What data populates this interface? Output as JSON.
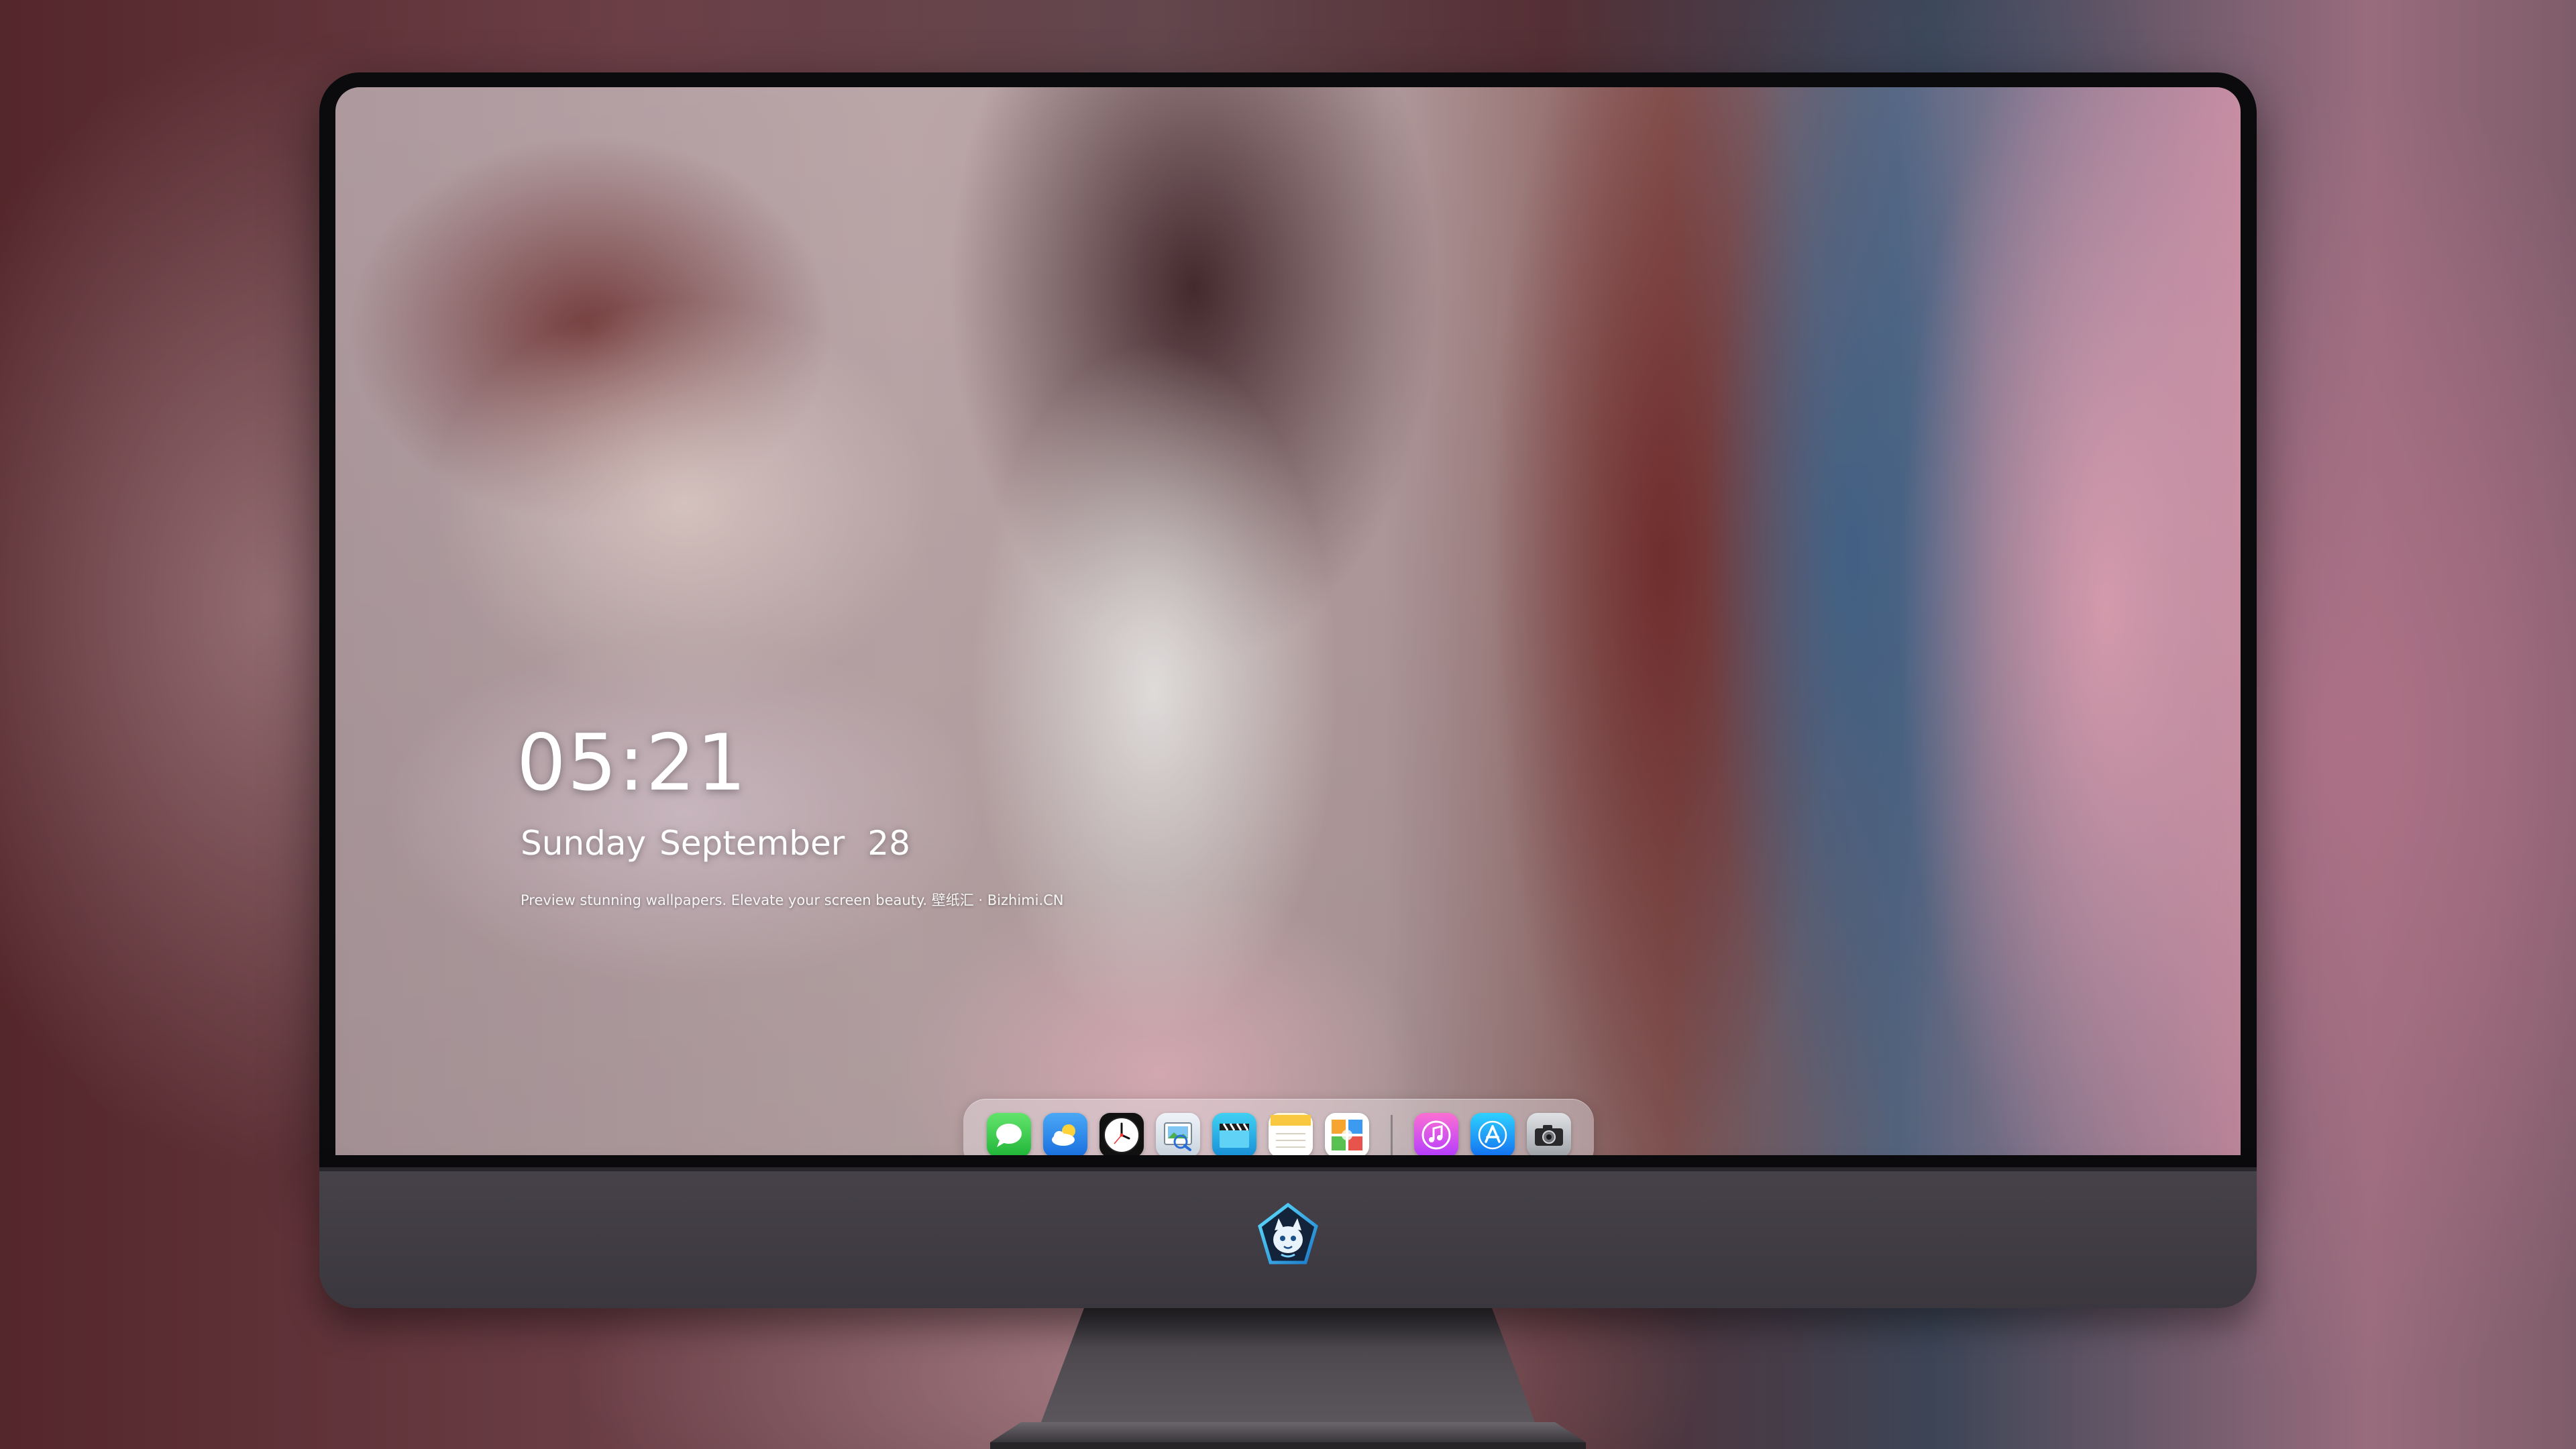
{
  "lock_screen": {
    "time": "05:21",
    "weekday": "Sunday",
    "month": "September",
    "day": "28",
    "caption": "Preview stunning wallpapers. Elevate your screen beauty. 壁纸汇 · Bizhimi.CN"
  },
  "dock": {
    "apps": [
      {
        "name": "Messages",
        "icon": "messages-icon"
      },
      {
        "name": "Weather",
        "icon": "weather-icon"
      },
      {
        "name": "Clock",
        "icon": "clock-icon"
      },
      {
        "name": "Preview",
        "icon": "preview-icon"
      },
      {
        "name": "Clips",
        "icon": "clapperboard-icon"
      },
      {
        "name": "Notes",
        "icon": "notes-icon"
      },
      {
        "name": "Photo Booth",
        "icon": "photos-icon"
      },
      {
        "name": "iTunes",
        "icon": "music-note-icon"
      },
      {
        "name": "App Store",
        "icon": "app-store-icon"
      },
      {
        "name": "Camera",
        "icon": "camera-icon"
      }
    ]
  },
  "colors": {
    "bezel": "#0b0b0d",
    "chin": "#47424a",
    "stand": "#4a464c",
    "text": "#ffffff"
  }
}
